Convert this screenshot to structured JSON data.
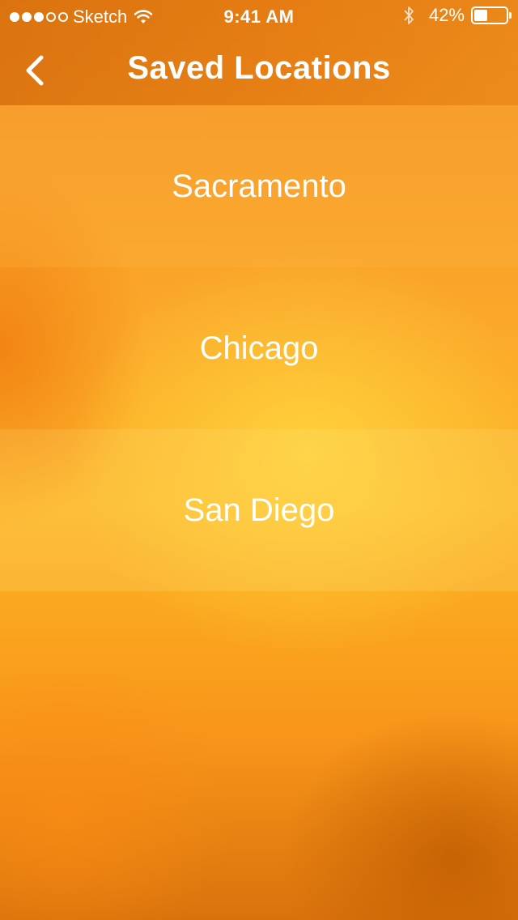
{
  "status_bar": {
    "carrier": "Sketch",
    "signal_bars_filled": 3,
    "signal_bars_total": 5,
    "time": "9:41 AM",
    "battery_percent": "42%",
    "battery_level": 0.42
  },
  "nav": {
    "title": "Saved Locations",
    "back_icon": "chevron-left-icon"
  },
  "locations": [
    "Sacramento",
    "Chicago",
    "San Diego"
  ],
  "colors": {
    "background_top": "#f28a1c",
    "background_mid": "#fdb524",
    "background_bottom": "#d9720c",
    "text": "#ffffff"
  }
}
